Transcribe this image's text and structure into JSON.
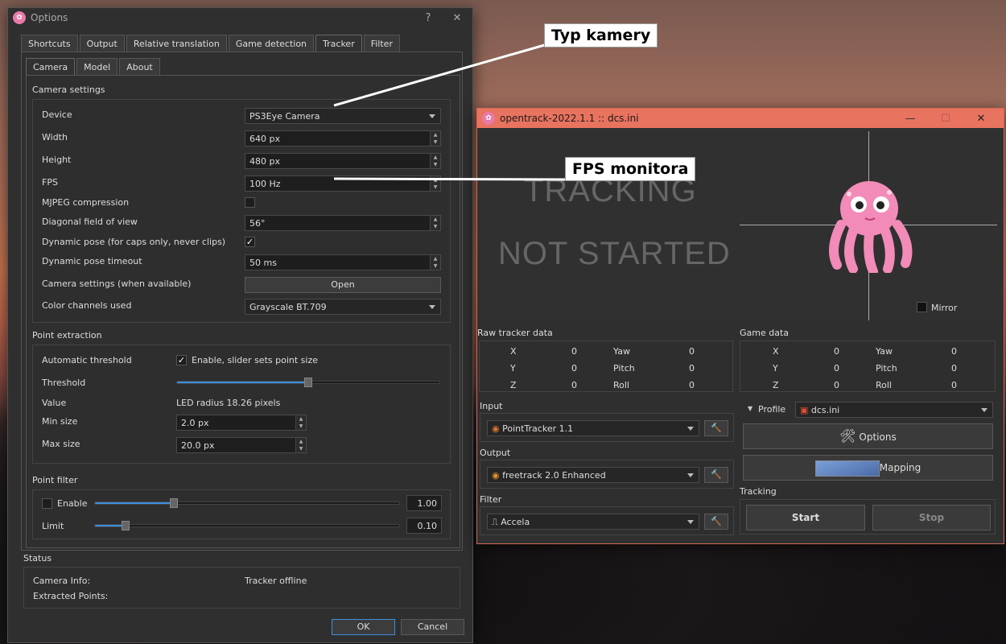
{
  "options": {
    "title": "Options",
    "help": "?",
    "close": "✕",
    "tabs": [
      "Shortcuts",
      "Output",
      "Relative translation",
      "Game detection",
      "Tracker",
      "Filter"
    ],
    "subtabs": [
      "Camera",
      "Model",
      "About"
    ],
    "camera_settings_title": "Camera settings",
    "rows": {
      "device_label": "Device",
      "device_value": "PS3Eye Camera",
      "width_label": "Width",
      "width_value": "640 px",
      "height_label": "Height",
      "height_value": "480 px",
      "fps_label": "FPS",
      "fps_value": "100 Hz",
      "mjpeg_label": "MJPEG compression",
      "fov_label": "Diagonal field of view",
      "fov_value": "56°",
      "dynpose_label": "Dynamic pose (for caps only, never clips)",
      "dynpose_timeout_label": "Dynamic pose timeout",
      "dynpose_timeout_value": "50 ms",
      "camsettings_label": "Camera settings (when available)",
      "open_button": "Open",
      "color_label": "Color channels used",
      "color_value": "Grayscale BT.709"
    },
    "point_extraction_title": "Point extraction",
    "pe": {
      "auto_label": "Automatic threshold",
      "auto_check": "Enable, slider sets point size",
      "threshold_label": "Threshold",
      "threshold_level": 0.5,
      "value_label": "Value",
      "value_text": "LED radius 18.26 pixels",
      "min_label": "Min size",
      "min_value": "2.0 px",
      "max_label": "Max size",
      "max_value": "20.0 px"
    },
    "point_filter_title": "Point filter",
    "pf": {
      "enable_label": "Enable",
      "enable_value": "1.00",
      "enable_level": 0.26,
      "limit_label": "Limit",
      "limit_value": "0.10",
      "limit_level": 0.1
    },
    "status_title": "Status",
    "status": {
      "camera_info_label": "Camera Info:",
      "tracker_state": "Tracker offline",
      "extracted_label": "Extracted Points:"
    },
    "ok": "OK",
    "cancel": "Cancel"
  },
  "opentrack": {
    "title": "opentrack-2022.1.1 :: dcs.ini",
    "minimize": "—",
    "maximize": "☐",
    "close": "✕",
    "status_line1": "TRACKING",
    "status_line2": "NOT STARTED",
    "mirror": "Mirror",
    "raw_title": "Raw tracker data",
    "game_title": "Game data",
    "axes_left": [
      "X",
      "Y",
      "Z"
    ],
    "axes_right": [
      "Yaw",
      "Pitch",
      "Roll"
    ],
    "zero": "0",
    "input_title": "Input",
    "input_value": "PointTracker 1.1",
    "output_title": "Output",
    "output_value": "freetrack 2.0 Enhanced",
    "filter_title": "Filter",
    "filter_value": "Accela",
    "profile_label": "Profile",
    "profile_value": "dcs.ini",
    "options_button": "Options",
    "mapping_button": "Mapping",
    "tracking_title": "Tracking",
    "start": "Start",
    "stop": "Stop"
  },
  "callouts": {
    "camera_type": "Typ kamery",
    "fps_monitor": "FPS monitora"
  }
}
